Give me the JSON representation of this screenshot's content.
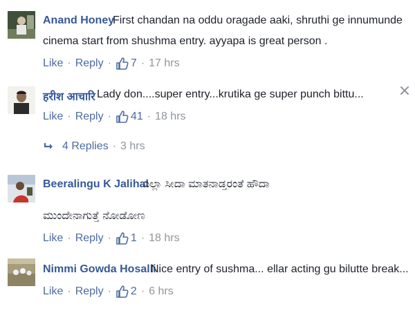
{
  "comments": [
    {
      "name": "Anand Honey",
      "text_line1": "First chandan na oddu oragade aaki, shruthi ge innumunde",
      "text_line2": "cinema start from shushma entry. ayyapa is great person .",
      "like_label": "Like",
      "reply_label": "Reply",
      "like_count": "7",
      "time": "17 hrs"
    },
    {
      "name": "हरीश आचारि",
      "text_line1": "Lady don....super entry...krutika ge super punch bittu...",
      "like_label": "Like",
      "reply_label": "Reply",
      "like_count": "41",
      "time": "18 hrs",
      "replies_label": "4 Replies",
      "replies_time": "3 hrs"
    },
    {
      "name": "Beeralingu K Jalihal",
      "text_line1": "ಎಲ್ಲಾ ಸೀದಾ ಮಾತನಾಡ್ತರಂತೆ ಹೌದಾ",
      "text_line2": "ಮುಂದೇನಾಗುತ್ತೆ ನೋಡೋಣ",
      "like_label": "Like",
      "reply_label": "Reply",
      "like_count": "1",
      "time": "18 hrs"
    },
    {
      "name": "Nimmi Gowda Hosalli",
      "text_line1": "Nice entry of sushma... ellar acting gu bilutte break...",
      "like_label": "Like",
      "reply_label": "Reply",
      "like_count": "2",
      "time": "6 hrs"
    }
  ],
  "colors": {
    "name": "#365899",
    "link": "#4b6aa1",
    "meta": "#90949c",
    "text": "#1d2129"
  },
  "icons": {
    "like": "thumbs-up-icon",
    "reply_arrow": "reply-arrow-icon",
    "close": "close-icon"
  }
}
